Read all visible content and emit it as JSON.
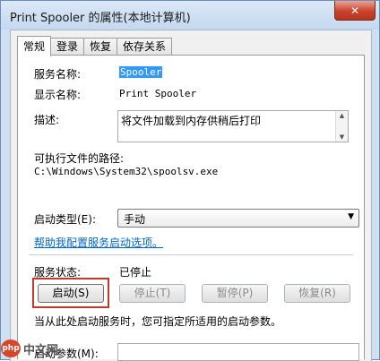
{
  "window": {
    "title": "Print Spooler 的属性(本地计算机)",
    "close_symbol": "✕"
  },
  "tabs": [
    {
      "label": "常规",
      "active": true
    },
    {
      "label": "登录",
      "active": false
    },
    {
      "label": "恢复",
      "active": false
    },
    {
      "label": "依存关系",
      "active": false
    }
  ],
  "general": {
    "service_name_label": "服务名称:",
    "service_name_value": "Spooler",
    "display_name_label": "显示名称:",
    "display_name_value": "Print Spooler",
    "description_label": "描述:",
    "description_value": "将文件加载到内存供稍后打印",
    "path_label": "可执行文件的路径:",
    "path_value": "C:\\Windows\\System32\\spoolsv.exe",
    "startup_type_label": "启动类型(E):",
    "startup_type_value": "手动",
    "help_link": "帮助我配置服务启动选项。",
    "status_label": "服务状态:",
    "status_value": "已停止",
    "start_note": "当从此处启动服务时，您可指定所适用的启动参数。",
    "start_params_label": "启动参数(M):",
    "start_params_value": ""
  },
  "buttons": {
    "start": "启动(S)",
    "stop": "停止(T)",
    "pause": "暂停(P)",
    "resume": "恢复(R)"
  },
  "watermark": {
    "logo": "php",
    "text": "中文网"
  },
  "colors": {
    "highlight_frame": "#c0392b",
    "selection": "#3399ff",
    "link": "#0066cc"
  }
}
